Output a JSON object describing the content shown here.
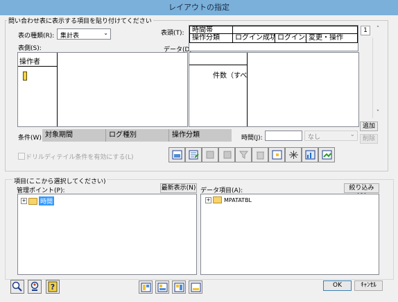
{
  "window": {
    "title": "レイアウトの指定"
  },
  "paste_section": {
    "label": "問い合わせ表に表示する項目を貼り付けてください",
    "table_type_label": "表の種類(R):",
    "table_type_value": "集計表",
    "table_side_label": "表側(S):",
    "table_head_label": "表頭(T):",
    "data_label": "データ(D):",
    "page_number": "1",
    "table_side_header": "操作者",
    "table_head_row1": "時間帯",
    "table_head_row2": [
      "操作分類",
      "ログイン成功",
      "ログイン失敗",
      "変更・操作"
    ],
    "data_cell": "件数（すべて）",
    "condition_label": "条件(W):",
    "conditions": [
      "対象期間",
      "ログ種別",
      "操作分類"
    ],
    "time_label": "時間(J):",
    "time_value": "",
    "time_select_value": "なし",
    "add_button": "追加",
    "delete_button": "削除",
    "drilldetail_checkbox": "ドリルディテイル条件を有効にする(L)"
  },
  "items_section": {
    "label": "項目(ここから選択してください)",
    "management_point_label": "管理ポイント(P):",
    "refresh_button": "最新表示(N)",
    "tree_left": [
      {
        "label": "時間",
        "selected": true
      }
    ],
    "data_item_label": "データ項目(A):",
    "narrow_button": "絞り込み(Q)",
    "tree_right": [
      {
        "label": "MPATATBL",
        "selected": false
      }
    ]
  },
  "footer": {
    "ok_button": "OK",
    "cancel_button": "ｷｬﾝｾﾙ"
  },
  "colors": {
    "titlebar": "#7ab0d9",
    "selection": "#3399ff",
    "folder": "#f7d36a"
  }
}
